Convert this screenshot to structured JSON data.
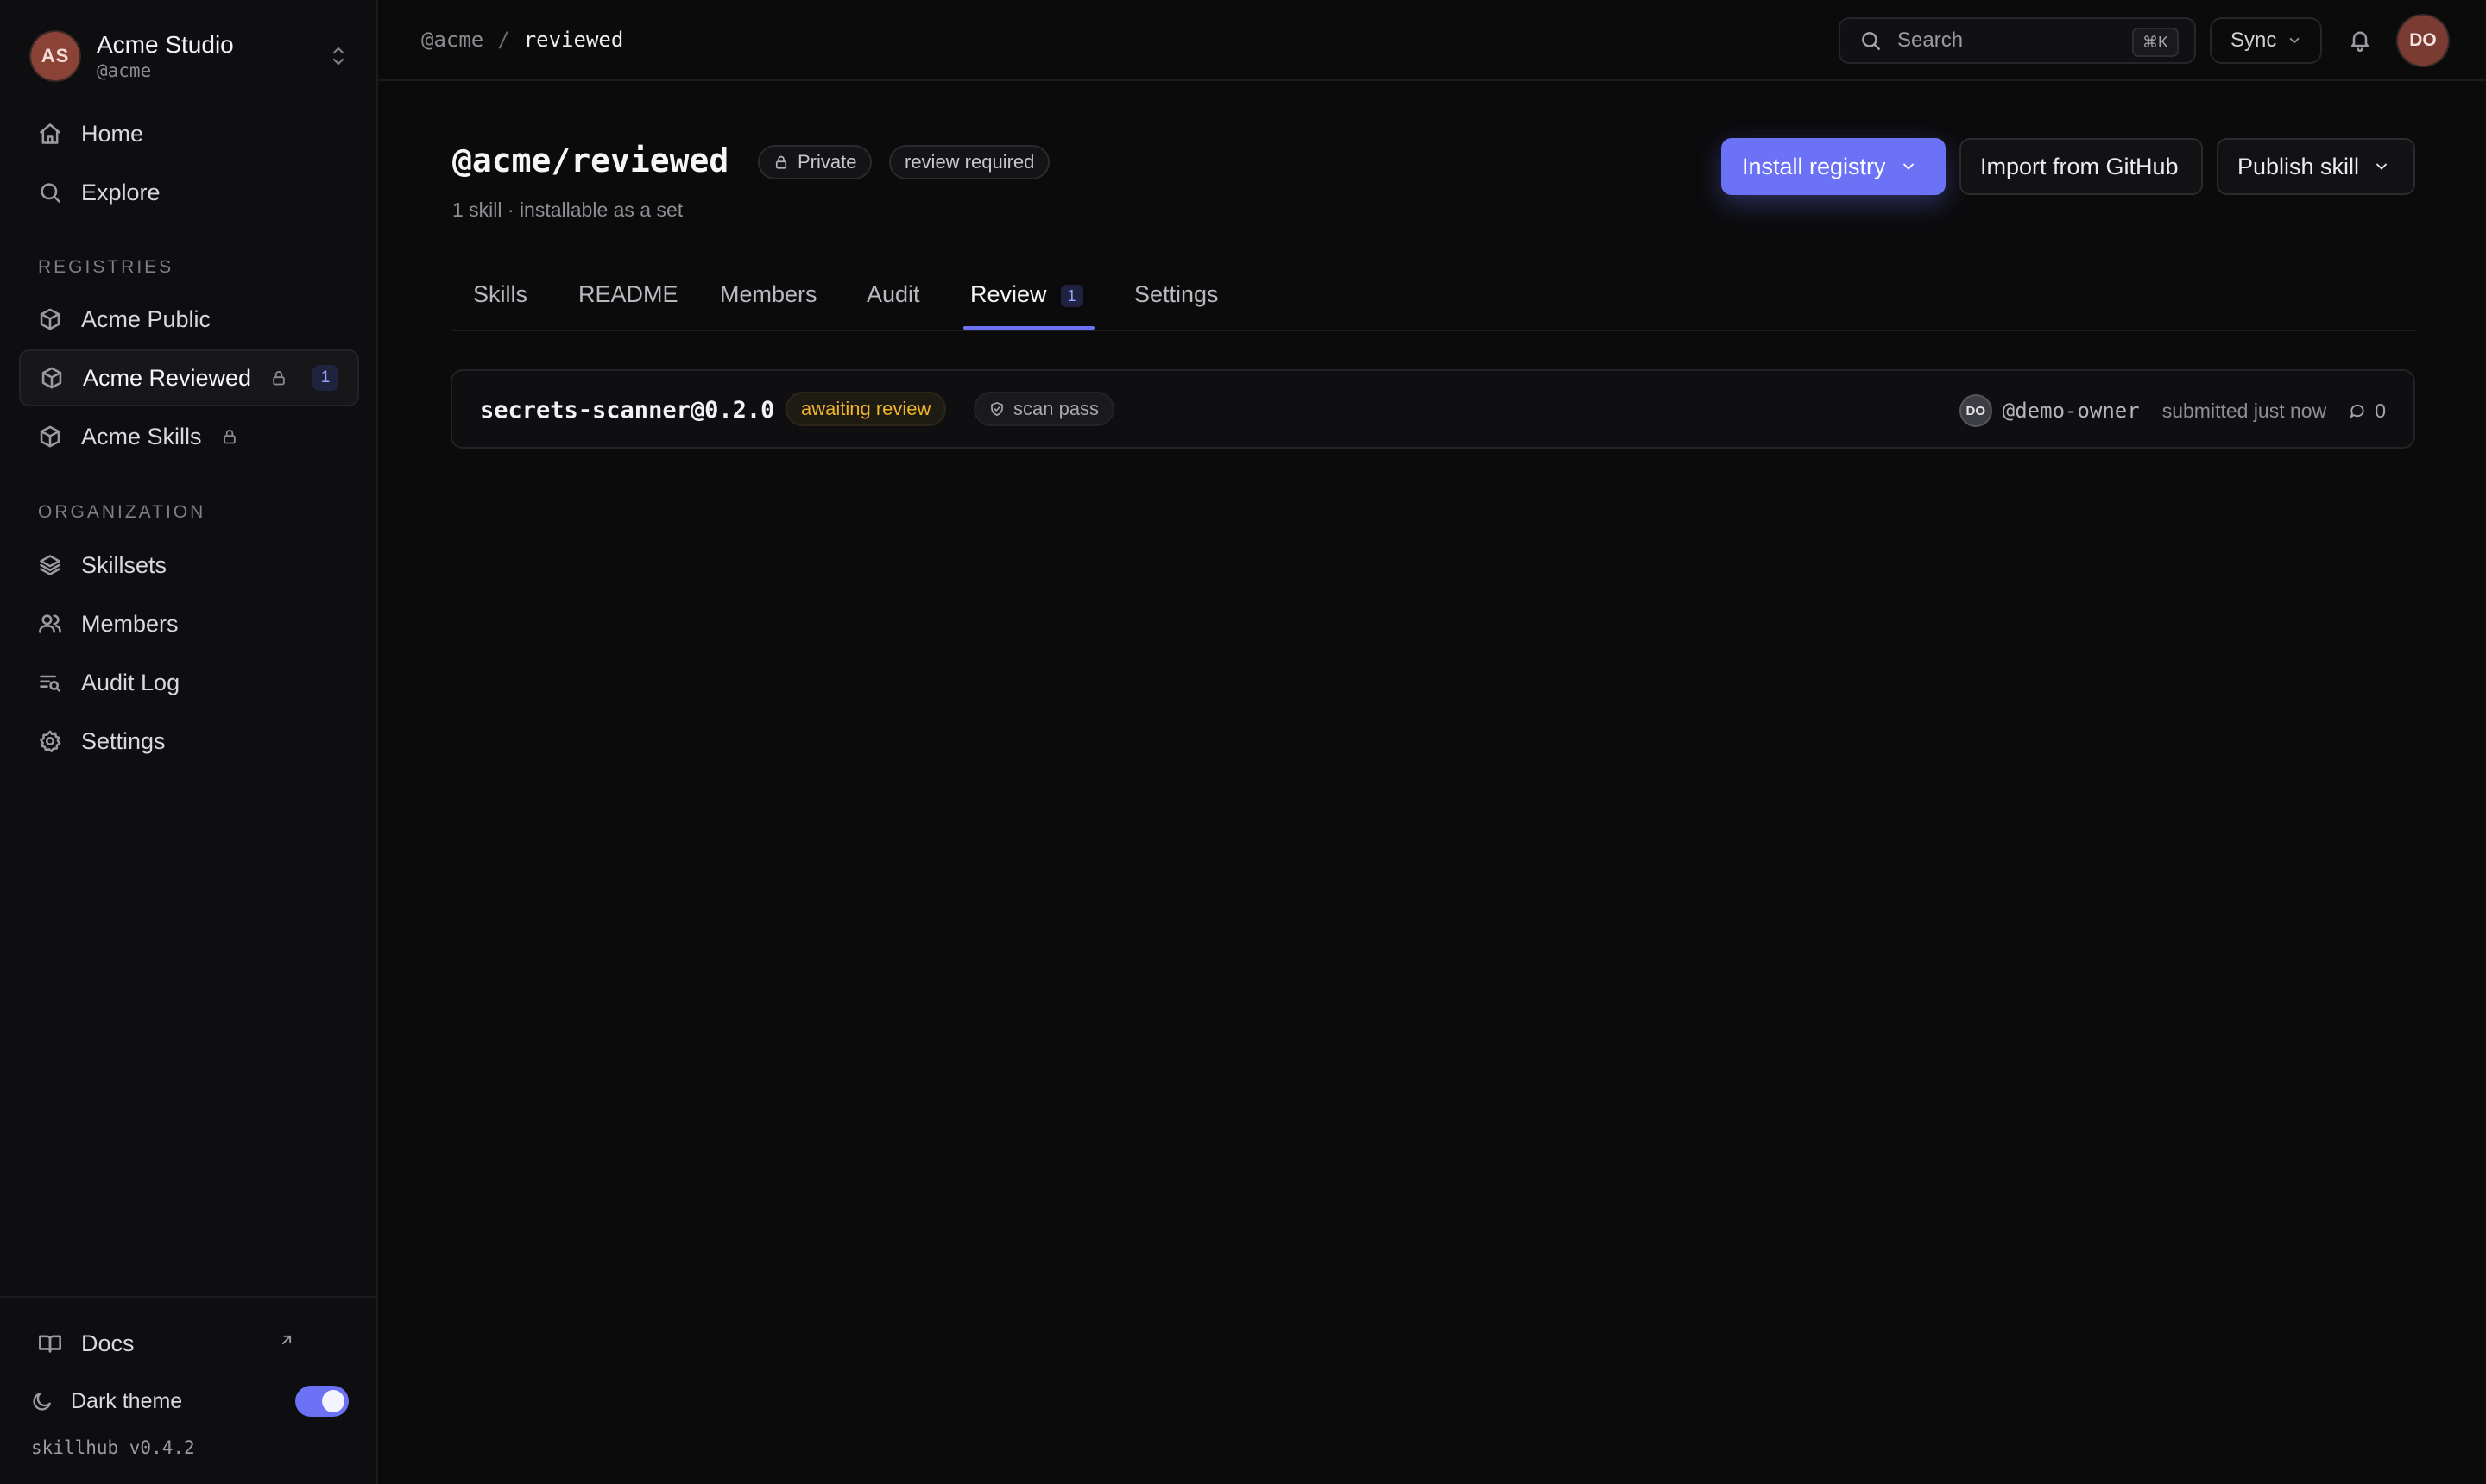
{
  "sidebar": {
    "org_avatar": "AS",
    "org_name": "Acme Studio",
    "org_handle": "@acme",
    "nav": [
      {
        "label": "Home",
        "icon": "home-icon"
      },
      {
        "label": "Explore",
        "icon": "search-icon"
      }
    ],
    "registries_label": "REGISTRIES",
    "registries": [
      {
        "label": "Acme Public",
        "icon": "package-icon",
        "locked": false
      },
      {
        "label": "Acme Reviewed",
        "icon": "package-icon",
        "locked": true,
        "count": "1",
        "active": true
      },
      {
        "label": "Acme Skills",
        "icon": "package-icon",
        "locked": true
      }
    ],
    "organization_label": "ORGANIZATION",
    "organization": [
      {
        "label": "Skillsets",
        "icon": "layers-icon"
      },
      {
        "label": "Members",
        "icon": "users-icon"
      },
      {
        "label": "Audit Log",
        "icon": "audit-log-icon"
      },
      {
        "label": "Settings",
        "icon": "gear-icon"
      }
    ],
    "docs_label": "Docs",
    "theme_label": "Dark theme",
    "theme_on": true,
    "version": "skillhub v0.4.2"
  },
  "topbar": {
    "breadcrumb": [
      "@acme",
      "/",
      "reviewed"
    ],
    "search_placeholder": "Search",
    "search_shortcut": "⌘K",
    "sync_label": "Sync",
    "user_avatar": "DO"
  },
  "registry": {
    "title": "@acme/reviewed",
    "visibility": "Private",
    "policy": "review required",
    "subtitle": "1 skill · installable as a set"
  },
  "actions": {
    "install": "Install registry",
    "import": "Import from GitHub",
    "publish": "Publish skill"
  },
  "tabs": [
    {
      "label": "Skills"
    },
    {
      "label": "README"
    },
    {
      "label": "Members"
    },
    {
      "label": "Audit"
    },
    {
      "label": "Review",
      "badge": "1",
      "active": true
    },
    {
      "label": "Settings"
    }
  ],
  "review_items": [
    {
      "skill": "secrets-scanner@0.2.0",
      "status": "awaiting review",
      "scan": "scan pass",
      "owner_avatar": "DO",
      "owner": "@demo-owner",
      "submitted": "submitted just now",
      "comments": "0"
    }
  ],
  "colors": {
    "accent": "#6c72f6",
    "background": "#0b0b0c",
    "awaiting": "#f0b429"
  }
}
